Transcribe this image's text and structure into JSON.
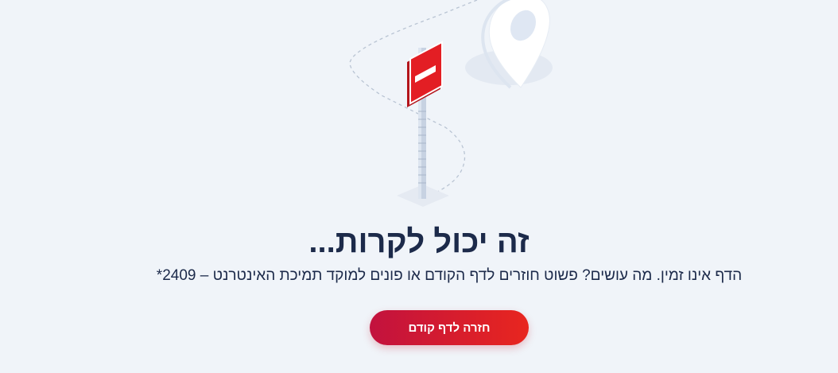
{
  "error_page": {
    "title": "זה יכול לקרות...",
    "message": "הדף אינו זמין. מה עושים? פשוט חוזרים לדף הקודם או פונים למוקד תמיכת האינטרנט – 2409*",
    "back_button_label": "חזרה לדף קודם"
  },
  "colors": {
    "background": "#f0f4f9",
    "title_text": "#1c2a4a",
    "button_gradient_start": "#c2123e",
    "button_gradient_end": "#e8261f",
    "sign_red": "#e31e24"
  },
  "icons": {
    "illustration": "no-entry-sign-illustration",
    "location_pin": "location-pin-icon"
  }
}
